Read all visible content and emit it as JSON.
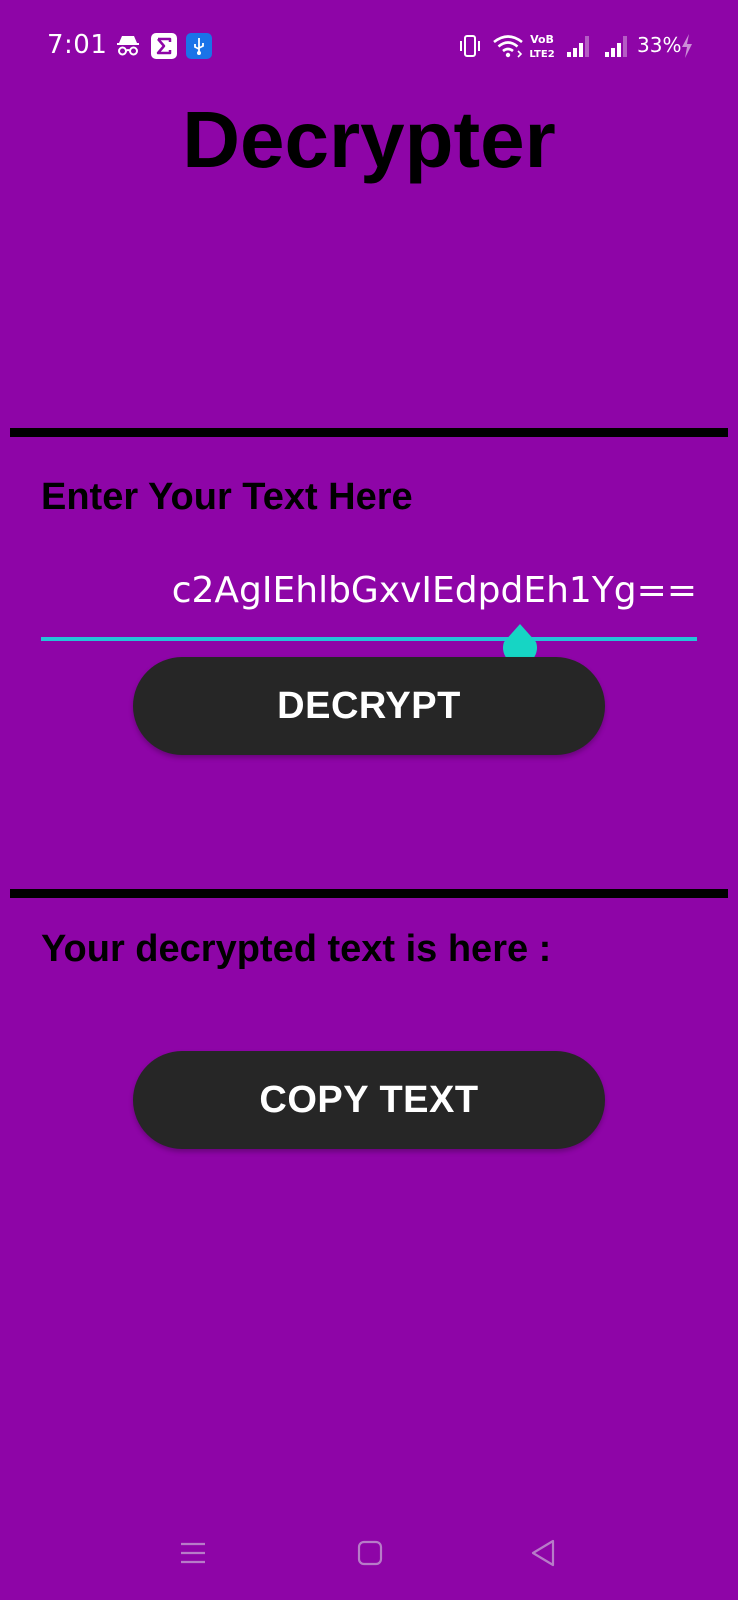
{
  "status_bar": {
    "time": "7:01",
    "battery_percent": "33%",
    "left_icons": [
      "incognito-icon",
      "sigma-app-icon",
      "usb-icon"
    ],
    "right_icons": [
      "vibrate-icon",
      "wifi-icon",
      "volte-icon",
      "signal-icon",
      "signal-icon",
      "charging-icon"
    ]
  },
  "app": {
    "title": "Decrypter"
  },
  "input_section": {
    "label": "Enter Your Text Here",
    "input_value": "c2AgIEhlbGxvIEdpdEh1Yg==",
    "decrypt_button": "DECRYPT"
  },
  "output_section": {
    "label": "Your decrypted text is here :",
    "output_value": "",
    "copy_button": "COPY TEXT"
  },
  "navigation": {
    "items": [
      "menu-icon",
      "home-icon",
      "back-icon"
    ]
  },
  "colors": {
    "background": "#8e05a7",
    "button": "#262626",
    "accent_line": "#25c3d9",
    "cursor_handle": "#16d5c4"
  }
}
